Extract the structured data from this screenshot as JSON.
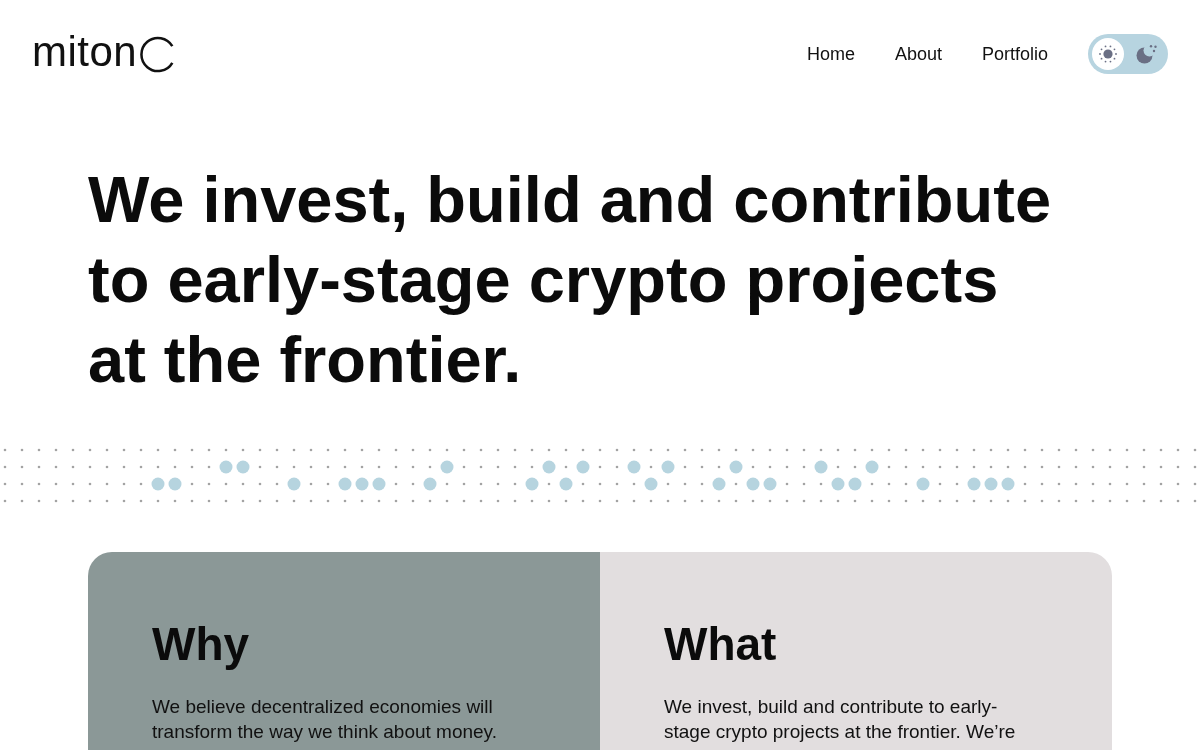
{
  "header": {
    "logo": "miton",
    "nav": [
      "Home",
      "About",
      "Portfolio"
    ],
    "theme_toggle": {
      "dark": false
    }
  },
  "hero": {
    "headline": "We invest, build and contribute to early-stage crypto projects at the frontier."
  },
  "cards": [
    {
      "title": "Why",
      "text": "We believe decentralized economies will transform the way we think about money."
    },
    {
      "title": "What",
      "text": "We invest, build and contribute to early-stage crypto projects at the frontier. We’re"
    }
  ]
}
